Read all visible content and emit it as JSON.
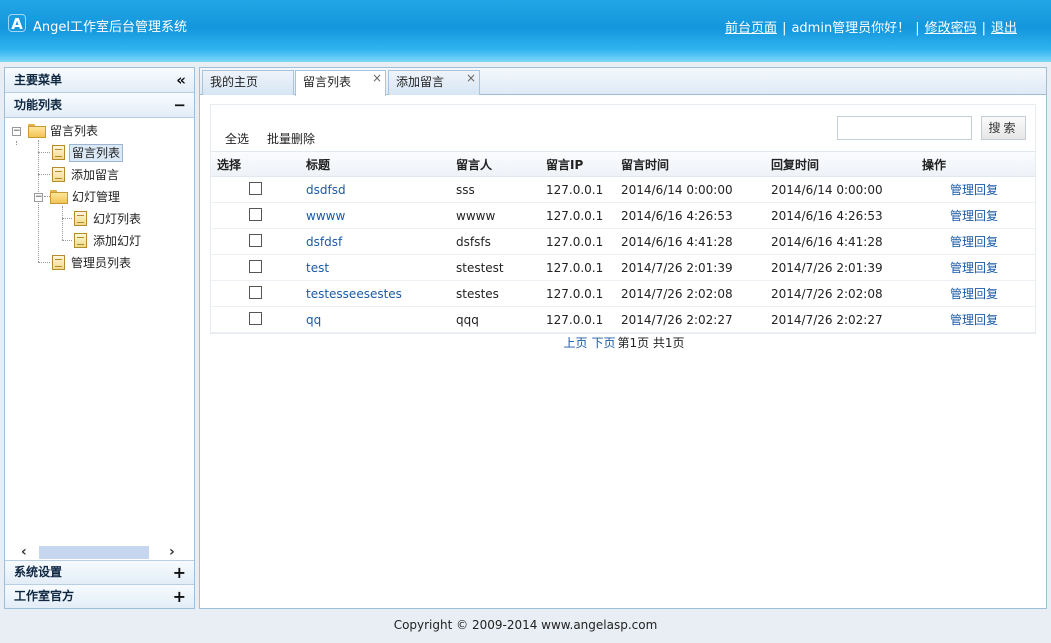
{
  "header": {
    "title": "Angel工作室后台管理系统",
    "logo_letter": "A",
    "links": {
      "front_page": "前台页面",
      "greeting": "admin管理员你好！",
      "change_password": "修改密码",
      "logout": "退出",
      "separator": "|"
    }
  },
  "sidebar": {
    "main_menu": "主要菜单",
    "collapse_all": "«",
    "function_list": "功能列表",
    "function_ctl": "−",
    "tree": {
      "root": "留言列表",
      "message_list": "留言列表",
      "add_message": "添加留言",
      "slide_manage": "幻灯管理",
      "slide_list": "幻灯列表",
      "add_slide": "添加幻灯",
      "admin_list": "管理员列表"
    },
    "system_settings": "系统设置",
    "studio_official": "工作室官方",
    "expand_ctl": "+",
    "scroll_left": "‹",
    "scroll_right": "›"
  },
  "tabs": [
    {
      "label": "我的主页"
    },
    {
      "label": "留言列表"
    },
    {
      "label": "添加留言"
    }
  ],
  "tab_close": "×",
  "toolbar": {
    "select_all": "全选",
    "batch_delete": "批量删除",
    "search_value": "",
    "search_button": "搜索"
  },
  "table": {
    "headers": {
      "select": "选择",
      "title": "标题",
      "author": "留言人",
      "ip": "留言IP",
      "time": "留言时间",
      "reply_time": "回复时间",
      "op": "操作"
    },
    "rows": [
      {
        "title": "dsdfsd",
        "author": "sss",
        "ip": "127.0.0.1",
        "time": "2014/6/14 0:00:00",
        "reply_time": "2014/6/14 0:00:00",
        "op": "管理回复"
      },
      {
        "title": "wwww",
        "author": "wwww",
        "ip": "127.0.0.1",
        "time": "2014/6/16 4:26:53",
        "reply_time": "2014/6/16 4:26:53",
        "op": "管理回复"
      },
      {
        "title": "dsfdsf",
        "author": "dsfsfs",
        "ip": "127.0.0.1",
        "time": "2014/6/16 4:41:28",
        "reply_time": "2014/6/16 4:41:28",
        "op": "管理回复"
      },
      {
        "title": "test",
        "author": "stestest",
        "ip": "127.0.0.1",
        "time": "2014/7/26 2:01:39",
        "reply_time": "2014/7/26 2:01:39",
        "op": "管理回复"
      },
      {
        "title": "testesseesestes",
        "author": "stestes",
        "ip": "127.0.0.1",
        "time": "2014/7/26 2:02:08",
        "reply_time": "2014/7/26 2:02:08",
        "op": "管理回复"
      },
      {
        "title": "qq",
        "author": "qqq",
        "ip": "127.0.0.1",
        "time": "2014/7/26 2:02:27",
        "reply_time": "2014/7/26 2:02:27",
        "op": "管理回复"
      }
    ]
  },
  "pager": {
    "prev": "上页",
    "next": "下页",
    "info": "第1页 共1页"
  },
  "footer": {
    "copyright": "Copyright © 2009-2014 www.angelasp.com"
  }
}
